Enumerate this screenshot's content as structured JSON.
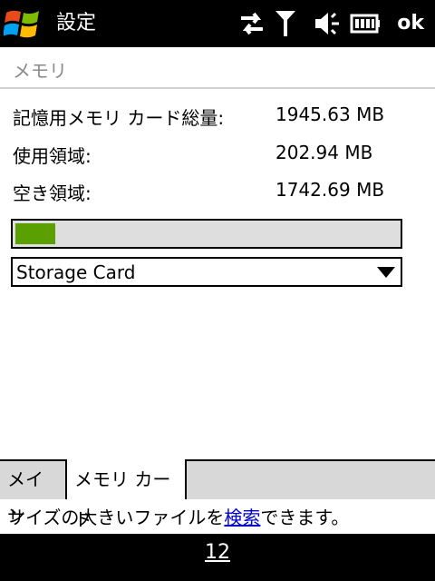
{
  "titlebar": {
    "title": "設定",
    "ok_label": "ok",
    "icons": [
      "windows-start-icon",
      "sync-arrows-icon",
      "signal-antenna-icon",
      "volume-muted-icon",
      "battery-icon"
    ]
  },
  "section": {
    "title": "メモリ"
  },
  "memory": {
    "total_label": "記憶用メモリ カード総量:",
    "total_value": "1945.63 MB",
    "used_label": "使用領域:",
    "used_value": "202.94 MB",
    "free_label": "空き領域:",
    "free_value": "1742.69 MB",
    "usage_fraction": 0.104
  },
  "storage_select": {
    "selected": "Storage Card"
  },
  "tabs": [
    {
      "label": "メイン",
      "active": false
    },
    {
      "label": "メモリ カード",
      "active": true
    }
  ],
  "hint": {
    "prefix": "サイズの大きいファイルを",
    "link": "検索",
    "suffix": "できます。"
  },
  "softkey": {
    "label": "12"
  },
  "colors": {
    "titlebar_bg": "#000000",
    "progress_fill": "#5aa000",
    "link": "#0000cc"
  }
}
